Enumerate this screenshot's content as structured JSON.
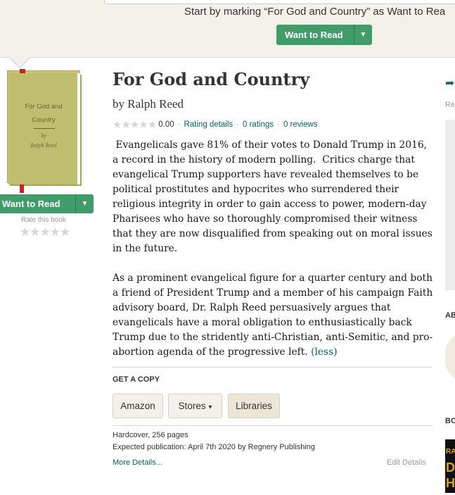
{
  "banner": {
    "prompt": "Start by marking “For God and Country” as Want to Rea",
    "want_to_read": "Want to Read",
    "dropdown_icon": "caret-down-icon"
  },
  "sidebar": {
    "cover": {
      "title_line1": "For God and",
      "title_line2": "Country",
      "by": "by",
      "author": "Ralph Reed"
    },
    "want_to_read": "Want to Read",
    "rate_label": "Rate this book",
    "rate_stars": "★★★★★"
  },
  "book": {
    "title": "For God and Country",
    "byline": "by Ralph Reed",
    "stars": "★★★★★",
    "average": "0.00",
    "rating_details": "Rating details",
    "ratings": "0 ratings",
    "reviews": "0 reviews",
    "sep": "·",
    "description_p1": " Evangelicals gave 81% of their votes to Donald Trump in 2016, a record in the history of modern polling.  Critics charge that evangelical Trump supporters have revealed themselves to be political prostitutes and hypocrites who surrendered their religious integrity in order to gain access to power, modern-day Pharisees who have so thoroughly compromised their witness that they are now disqualified from speaking out on moral issues in the future.",
    "description_p2": "As a prominent evangelical figure for a quarter century and both a friend of President Trump and a member of his campaign Faith advisory board, Dr. Ralph Reed persuasively argues that evangelicals have a moral obligation to enthusiastically back Trump due to the stridently anti-Christian, anti-Semitic, and pro-abortion agenda of the progressive left.",
    "less_link": "(less)"
  },
  "get_copy": {
    "heading": "GET A COPY",
    "amazon": "Amazon",
    "stores": "Stores",
    "stores_caret": "▾",
    "libraries": "Libraries"
  },
  "details": {
    "format": "Hardcover, 256 pages",
    "publication": "Expected publication: April 7th 2020 by Regnery Publishing",
    "more_details": "More Details...",
    "edit_details": "Edit Details"
  },
  "right_column": {
    "share_icon": "share-arrow-icon",
    "re": "Re",
    "ab": "AB",
    "bo": "BO",
    "book_letters": [
      "RAL",
      "DA",
      "HO"
    ]
  }
}
